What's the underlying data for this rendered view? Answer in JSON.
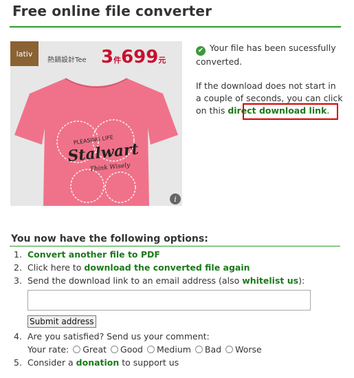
{
  "header": {
    "title": "Free online file converter"
  },
  "ad": {
    "logo_text": "lativ",
    "product_text": "熱銷設計Tee",
    "price_count": "3",
    "price_unit": "件",
    "price_value": "699",
    "price_currency": "元",
    "shirt_text_top": "PLEASING LIFE",
    "shirt_text_main": "Stalwart",
    "shirt_text_bottom": "Think Wisely",
    "shirt_color": "#f0728a",
    "info_icon": "i"
  },
  "status": {
    "icon": "check-icon",
    "message": "Your file has been sucessfully converted."
  },
  "download_note": {
    "text_before": "If the download does not start in a couple of seconds, you can click on this ",
    "link_label": "direct download link",
    "text_after": "."
  },
  "options": {
    "heading": "You now have the following options:",
    "item1": {
      "num": "1.",
      "link": "Convert another file to PDF"
    },
    "item2": {
      "num": "2.",
      "text": "Click here to ",
      "link": "download the converted file again"
    },
    "item3": {
      "num": "3.",
      "text": "Send the download link to an email address (also ",
      "link": "whitelist us",
      "text_after": "):",
      "input_value": "",
      "submit_label": "Submit address"
    },
    "item4": {
      "num": "4.",
      "text": "Are you satisfied? Send us your comment:",
      "rate_label": "Your rate:",
      "rates": [
        "Great",
        "Good",
        "Medium",
        "Bad",
        "Worse"
      ]
    },
    "item5": {
      "num": "5.",
      "text_before": "Consider a ",
      "link": "donation",
      "text_after": " to support us"
    }
  },
  "colors": {
    "accent": "#2e9a2e",
    "link": "#1a7a1a",
    "highlight": "#d40000"
  }
}
